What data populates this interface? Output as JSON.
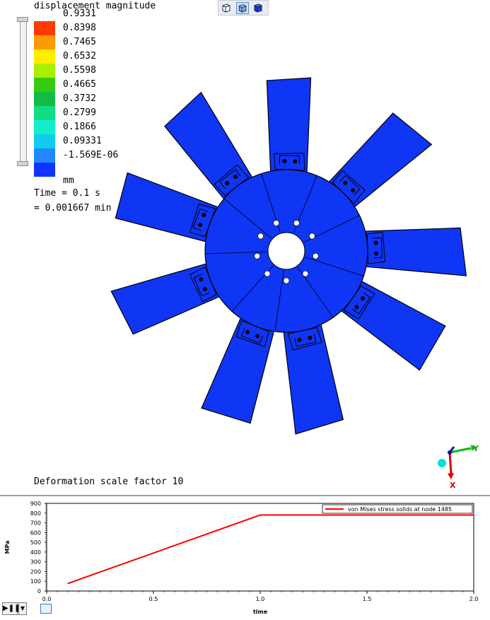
{
  "legend": {
    "title": "displacement magnitude",
    "labels": [
      "0.9331",
      "0.8398",
      "0.7465",
      "0.6532",
      "0.5598",
      "0.4665",
      "0.3732",
      "0.2799",
      "0.1866",
      "0.09331",
      "-1.569E-06"
    ],
    "colors": [
      "#ff3a00",
      "#ff9a00",
      "#ffee00",
      "#aaee00",
      "#33cc11",
      "#11bb44",
      "#11dd88",
      "#11eecc",
      "#11ccee",
      "#2288ff",
      "#1133ff"
    ],
    "unit": "mm"
  },
  "time": {
    "line1": "Time = 0.1 s",
    "line2": "= 0.001667 min"
  },
  "scale_note": "Deformation scale factor 10",
  "toolbar": {
    "icons": [
      "wireframe-cube-icon",
      "shaded-cube-icon",
      "solid-cube-icon"
    ]
  },
  "model_color": "#0f35f5",
  "triad": {
    "y_label": "Y",
    "x_label": "X"
  },
  "chart_data": {
    "type": "line",
    "legend_position": "top-right",
    "xlabel": "time",
    "ylabel": "MPa",
    "xlim": [
      0.0,
      2.0
    ],
    "ylim": [
      0,
      900
    ],
    "xticks": [
      "0.0",
      "0.5",
      "1.0",
      "1.5",
      "2.0"
    ],
    "yticks": [
      "0",
      "100",
      "200",
      "300",
      "400",
      "500",
      "600",
      "700",
      "800",
      "900"
    ],
    "series": [
      {
        "name": "von Mises stress solids at node 1485",
        "color": "#ff0000",
        "x": [
          0.1,
          0.5,
          1.0,
          2.0
        ],
        "y": [
          78,
          390,
          780,
          780
        ]
      }
    ]
  }
}
